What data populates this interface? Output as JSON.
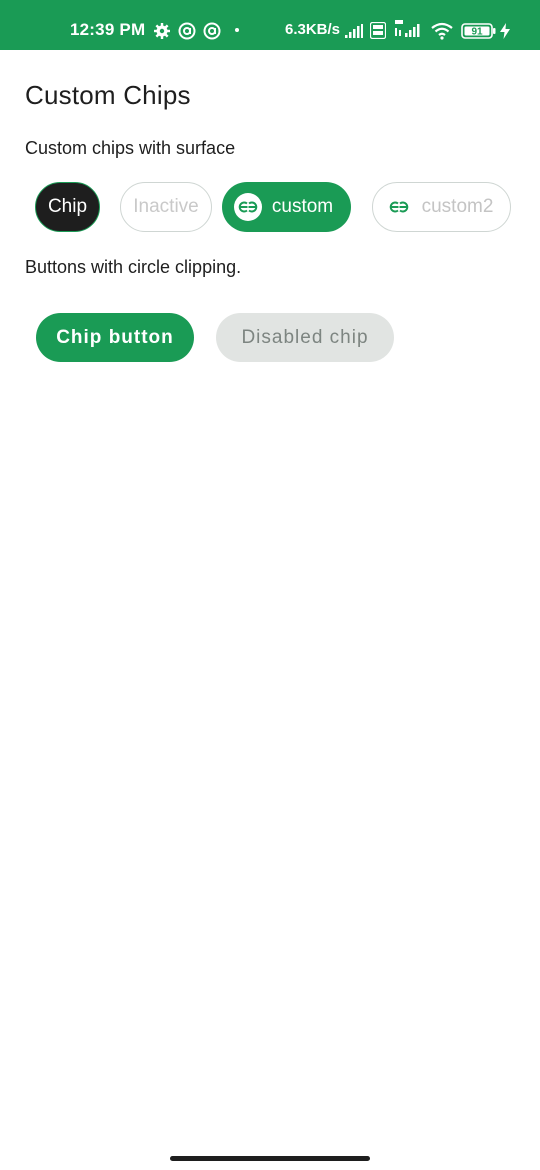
{
  "status_bar": {
    "time": "12:39 PM",
    "network_speed": "6.3KB/s",
    "battery_level": "91",
    "icons": [
      "settings-icon",
      "at-sign-icon",
      "at-sign-icon",
      "signal-icon",
      "volte-icon",
      "4g-signal-icon",
      "wifi-icon",
      "battery-icon",
      "charging-icon"
    ]
  },
  "page": {
    "title": "Custom Chips"
  },
  "section_chips": {
    "title": "Custom chips with surface",
    "chips": [
      {
        "label": "Chip",
        "state": "selected"
      },
      {
        "label": "Inactive",
        "state": "inactive"
      },
      {
        "label": "custom",
        "icon": "gfg-logo-icon",
        "state": "active"
      },
      {
        "label": "custom2",
        "icon": "gfg-logo-icon",
        "state": "inactive"
      }
    ]
  },
  "section_buttons": {
    "title": "Buttons with circle clipping.",
    "primary_label": "Chip button",
    "disabled_label": "Disabled chip"
  },
  "colors": {
    "accent": "#1a9b55",
    "dark_chip": "#1e1e1e",
    "disabled_bg": "#e1e4e2",
    "border": "#cfd6d3"
  }
}
